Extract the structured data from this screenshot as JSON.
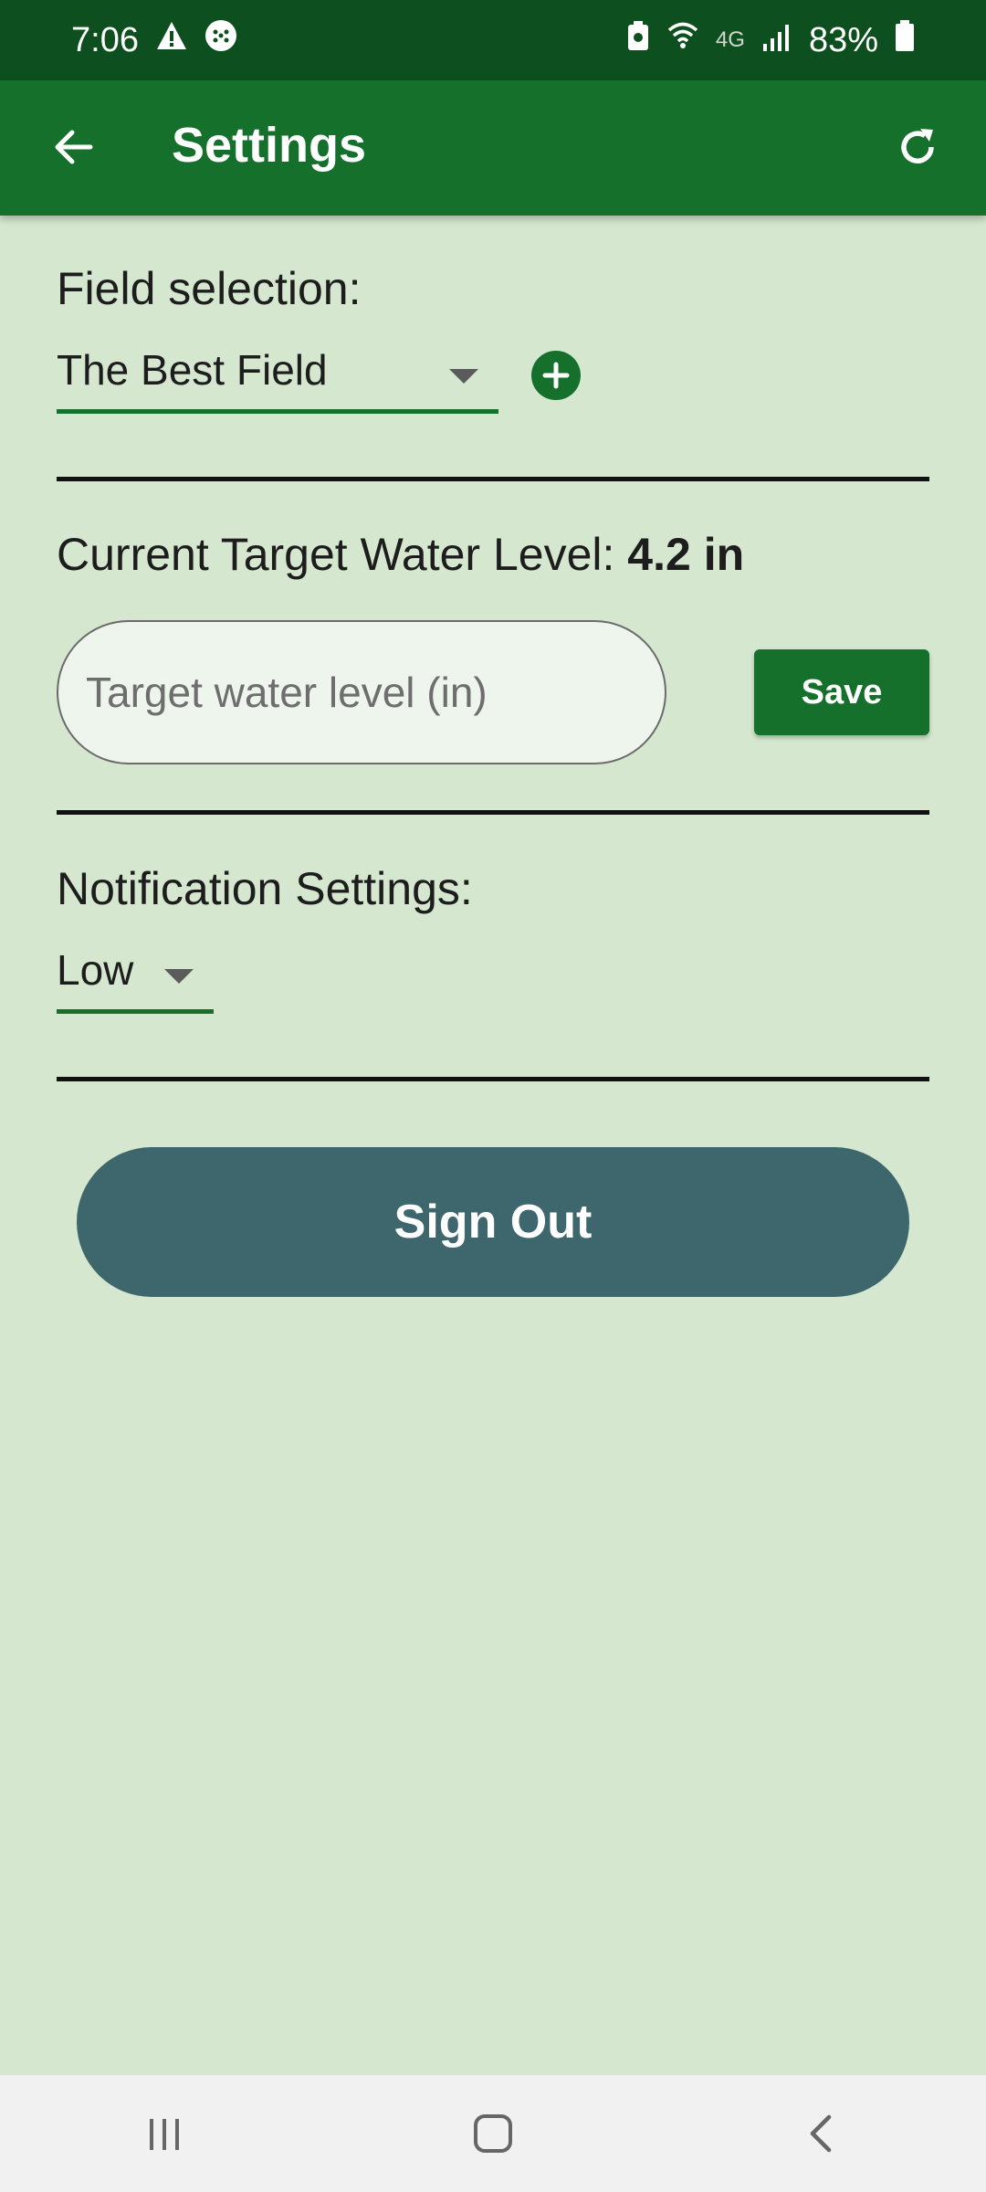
{
  "status_bar": {
    "time": "7:06",
    "network": "4G",
    "battery": "83%",
    "icons": [
      "warning-icon",
      "game-icon",
      "battery-saver-icon",
      "wifi-icon",
      "signal-icon",
      "battery-icon"
    ]
  },
  "app_bar": {
    "title": "Settings",
    "back_icon": "arrow-left-icon",
    "refresh_icon": "refresh-icon",
    "color": "#15702b"
  },
  "field_selection": {
    "label": "Field selection:",
    "selected": "The Best Field",
    "add_icon": "plus-circle-icon"
  },
  "target_water": {
    "label": "Current Target Water Level:",
    "value": "4.2 in",
    "input_placeholder": "Target water level (in)",
    "input_value": "",
    "save_label": "Save"
  },
  "notifications": {
    "label": "Notification Settings:",
    "selected": "Low"
  },
  "sign_out": {
    "label": "Sign Out",
    "color": "#3d676d"
  },
  "nav_bar": {
    "items": [
      "recents-icon",
      "home-icon",
      "back-icon"
    ]
  }
}
